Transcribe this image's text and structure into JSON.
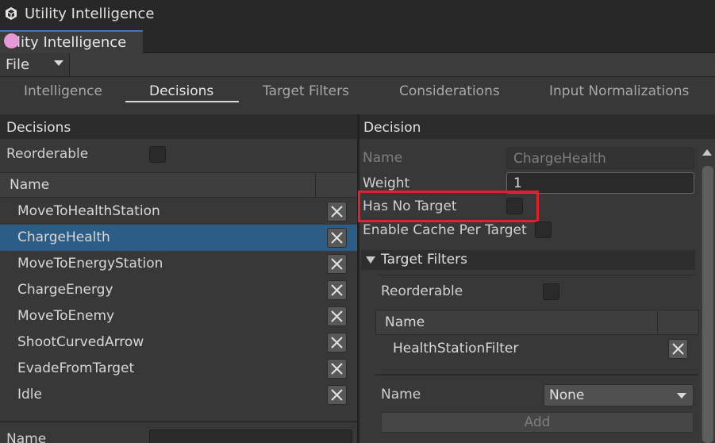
{
  "window": {
    "title": "Utility Intelligence",
    "tab_label": "tility Intelligence"
  },
  "menu": {
    "file_label": "File"
  },
  "nav_tabs": [
    {
      "label": "Intelligence",
      "active": false
    },
    {
      "label": "Decisions",
      "active": true
    },
    {
      "label": "Target Filters",
      "active": false
    },
    {
      "label": "Considerations",
      "active": false
    },
    {
      "label": "Input Normalizations",
      "active": false
    }
  ],
  "left_pane": {
    "header": "Decisions",
    "reorderable_label": "Reorderable",
    "reorderable_checked": false,
    "list_header": "Name",
    "items": [
      {
        "label": "MoveToHealthStation",
        "selected": false
      },
      {
        "label": "ChargeHealth",
        "selected": true
      },
      {
        "label": "MoveToEnergyStation",
        "selected": false
      },
      {
        "label": "ChargeEnergy",
        "selected": false
      },
      {
        "label": "MoveToEnemy",
        "selected": false
      },
      {
        "label": "ShootCurvedArrow",
        "selected": false
      },
      {
        "label": "EvadeFromTarget",
        "selected": false
      },
      {
        "label": "Idle",
        "selected": false
      }
    ],
    "bottom_name_label": "Name"
  },
  "right_pane": {
    "header": "Decision",
    "name_label": "Name",
    "name_value": "ChargeHealth",
    "weight_label": "Weight",
    "weight_value": "1",
    "has_no_target_label": "Has No Target",
    "has_no_target_checked": false,
    "enable_cache_label": "Enable Cache Per Target",
    "enable_cache_checked": false,
    "target_filters": {
      "foldout_label": "Target Filters",
      "expanded": true,
      "reorderable_label": "Reorderable",
      "list_header": "Name",
      "items": [
        {
          "label": "HealthStationFilter"
        }
      ],
      "name_label": "Name",
      "dropdown_value": "None",
      "add_label": "Add"
    }
  },
  "colors": {
    "selection": "#2c5d87",
    "highlight_box": "#e0202b",
    "tab_accent": "#3a79bb"
  }
}
